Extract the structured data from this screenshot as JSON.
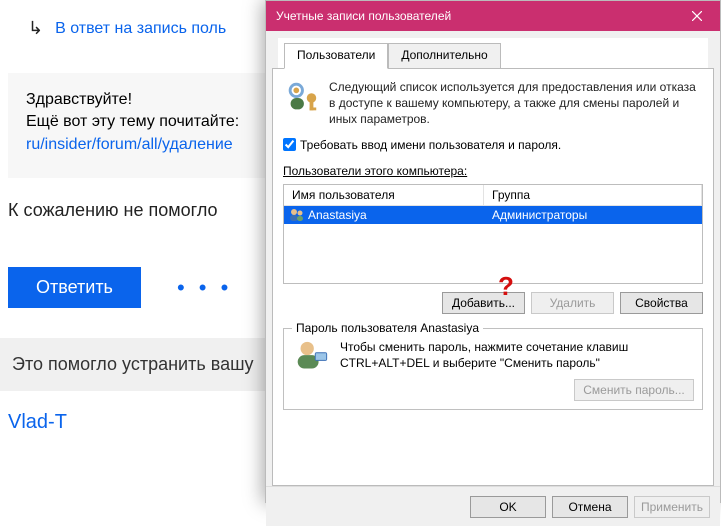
{
  "forum": {
    "reply_line": "В ответ на запись поль",
    "hello1": "Здравствуйте!",
    "hello2": "Ещё вот эту тему почитайте:",
    "link": "ru/insider/forum/all/удаление",
    "sorry": "К сожалению не помогло",
    "reply_btn": "Ответить",
    "more": "• • •",
    "help": "Это помогло устранить вашу",
    "vlad": "Vlad-T"
  },
  "dialog": {
    "title": "Учетные записи пользователей",
    "tabs": {
      "users": "Пользователи",
      "advanced": "Дополнительно"
    },
    "description": "Следующий список используется для предоставления или отказа в доступе к вашему компьютеру, а также для смены паролей и иных параметров.",
    "require_label": "Требовать ввод имени пользователя и пароля.",
    "users_header": "Пользователи этого компьютера:",
    "col_user": "Имя пользователя",
    "col_group": "Группа",
    "user_name": "Anastasiya",
    "user_group": "Администраторы",
    "qmark": "?",
    "btn_add": "Добавить...",
    "btn_del": "Удалить",
    "btn_prop": "Свойства",
    "fieldset_legend": "Пароль пользователя Anastasiya",
    "pwd_desc": "Чтобы сменить пароль, нажмите сочетание клавиш CTRL+ALT+DEL и выберите \"Сменить пароль\"",
    "btn_changepwd": "Сменить пароль...",
    "btn_ok": "OK",
    "btn_cancel": "Отмена",
    "btn_apply": "Применить"
  }
}
